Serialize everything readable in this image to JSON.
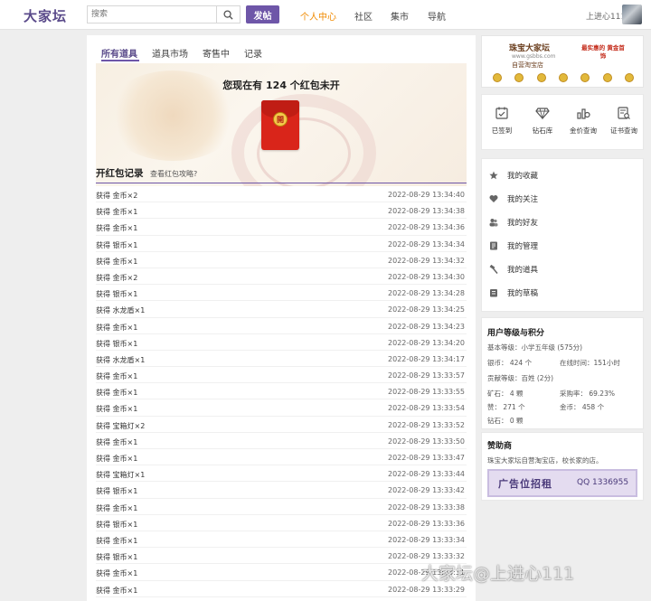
{
  "header": {
    "logo": "大家坛",
    "search_placeholder": "搜索",
    "post_button": "发帖",
    "nav": [
      "个人中心",
      "社区",
      "集市",
      "导航"
    ],
    "username": "上进心111"
  },
  "tabs": [
    "所有道具",
    "道具市场",
    "寄售中",
    "记录"
  ],
  "banner": {
    "text": "您现在有 124 个红包未开",
    "packet_char": "開"
  },
  "records": {
    "title": "开红包记录",
    "link": "查看红包攻略?",
    "rows": [
      {
        "item": "获得 金币×2",
        "time": "2022-08-29 13:34:40"
      },
      {
        "item": "获得 金币×1",
        "time": "2022-08-29 13:34:38"
      },
      {
        "item": "获得 金币×1",
        "time": "2022-08-29 13:34:36"
      },
      {
        "item": "获得 银币×1",
        "time": "2022-08-29 13:34:34"
      },
      {
        "item": "获得 金币×1",
        "time": "2022-08-29 13:34:32"
      },
      {
        "item": "获得 金币×2",
        "time": "2022-08-29 13:34:30"
      },
      {
        "item": "获得 银币×1",
        "time": "2022-08-29 13:34:28"
      },
      {
        "item": "获得 水龙盾×1",
        "time": "2022-08-29 13:34:25"
      },
      {
        "item": "获得 金币×1",
        "time": "2022-08-29 13:34:23"
      },
      {
        "item": "获得 银币×1",
        "time": "2022-08-29 13:34:20"
      },
      {
        "item": "获得 水龙盾×1",
        "time": "2022-08-29 13:34:17"
      },
      {
        "item": "获得 金币×1",
        "time": "2022-08-29 13:33:57"
      },
      {
        "item": "获得 金币×1",
        "time": "2022-08-29 13:33:55"
      },
      {
        "item": "获得 金币×1",
        "time": "2022-08-29 13:33:54"
      },
      {
        "item": "获得 宝箱灯×2",
        "time": "2022-08-29 13:33:52"
      },
      {
        "item": "获得 金币×1",
        "time": "2022-08-29 13:33:50"
      },
      {
        "item": "获得 金币×1",
        "time": "2022-08-29 13:33:47"
      },
      {
        "item": "获得 宝箱灯×1",
        "time": "2022-08-29 13:33:44"
      },
      {
        "item": "获得 银币×1",
        "time": "2022-08-29 13:33:42"
      },
      {
        "item": "获得 金币×1",
        "time": "2022-08-29 13:33:38"
      },
      {
        "item": "获得 银币×1",
        "time": "2022-08-29 13:33:36"
      },
      {
        "item": "获得 金币×1",
        "time": "2022-08-29 13:33:34"
      },
      {
        "item": "获得 银币×1",
        "time": "2022-08-29 13:33:32"
      },
      {
        "item": "获得 金币×1",
        "time": "2022-08-29 13:33:31"
      },
      {
        "item": "获得 金币×1",
        "time": "2022-08-29 13:33:29"
      }
    ]
  },
  "ad_top": {
    "brand": "珠宝大家坛",
    "site": "www.gsbbs.com",
    "store": "自营淘宝店",
    "slogan": "最实惠的 黄金首饰"
  },
  "quick": [
    "已签到",
    "钻石库",
    "金价查询",
    "证书查询"
  ],
  "menu": [
    {
      "label": "我的收藏",
      "icon": "star-icon"
    },
    {
      "label": "我的关注",
      "icon": "heart-icon"
    },
    {
      "label": "我的好友",
      "icon": "friends-icon"
    },
    {
      "label": "我的管理",
      "icon": "manage-icon"
    },
    {
      "label": "我的道具",
      "icon": "hammer-icon"
    },
    {
      "label": "我的草稿",
      "icon": "draft-icon"
    }
  ],
  "level": {
    "title": "用户等级与积分",
    "basic": "基本等级：小学五年级 (575分)",
    "silver": "银币：  424 个",
    "online": "在线时间：151小时",
    "contrib": "贡献等级：百姓 (2分)",
    "mine": "矿石：  4 颗",
    "rate": "采购率：  69.23%",
    "praise": "赞：  271 个",
    "gold": "金币：  458 个",
    "diamond": "钻石：  0 颗"
  },
  "sponsor": {
    "title": "赞助商",
    "desc": "珠宝大家坛自营淘宝店，校长家的店。",
    "ad_text": "广告位招租",
    "ad_qq": "QQ 1336955"
  },
  "watermark": "大家坛@上进心111",
  "colors": {
    "accent": "#6e56a8",
    "nav_active": "#f08a00",
    "packet_red": "#d9251a"
  }
}
